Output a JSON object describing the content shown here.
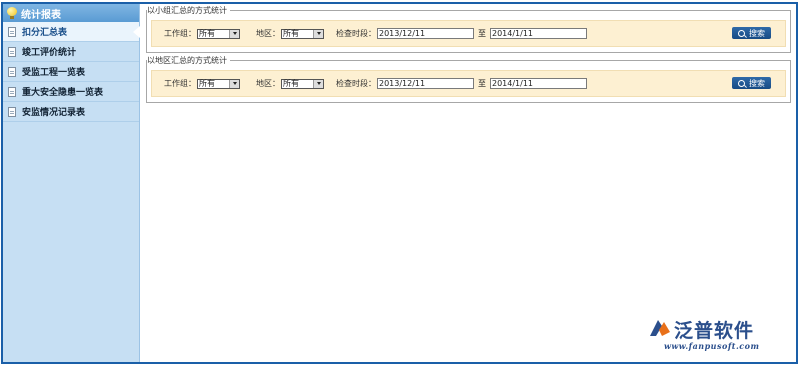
{
  "sidebar": {
    "header": "统计报表",
    "items": [
      {
        "label": "扣分汇总表",
        "active": true
      },
      {
        "label": "竣工评价统计",
        "active": false
      },
      {
        "label": "受监工程一览表",
        "active": false
      },
      {
        "label": "重大安全隐患一览表",
        "active": false
      },
      {
        "label": "安监情况记录表",
        "active": false
      }
    ]
  },
  "sections": [
    {
      "legend": "以小组汇总的方式统计",
      "group_label": "工作组：",
      "group_value": "所有",
      "region_label": "地区：",
      "region_value": "所有",
      "period_label": "检查时段：",
      "date_from": "2013/12/11",
      "to_label": "至",
      "date_to": "2014/1/11",
      "search_label": "搜索"
    },
    {
      "legend": "以地区汇总的方式统计",
      "group_label": "工作组：",
      "group_value": "所有",
      "region_label": "地区：",
      "region_value": "所有",
      "period_label": "检查时段：",
      "date_from": "2013/12/11",
      "to_label": "至",
      "date_to": "2014/1/11",
      "search_label": "搜索"
    }
  ],
  "logo": {
    "name": "泛普软件",
    "url": "www.fanpusoft.com"
  },
  "colors": {
    "border": "#1a5fa8",
    "sidebar_bg": "#c6dff3",
    "filter_bar_bg": "#fdf0d2",
    "search_button": "#174b84"
  }
}
